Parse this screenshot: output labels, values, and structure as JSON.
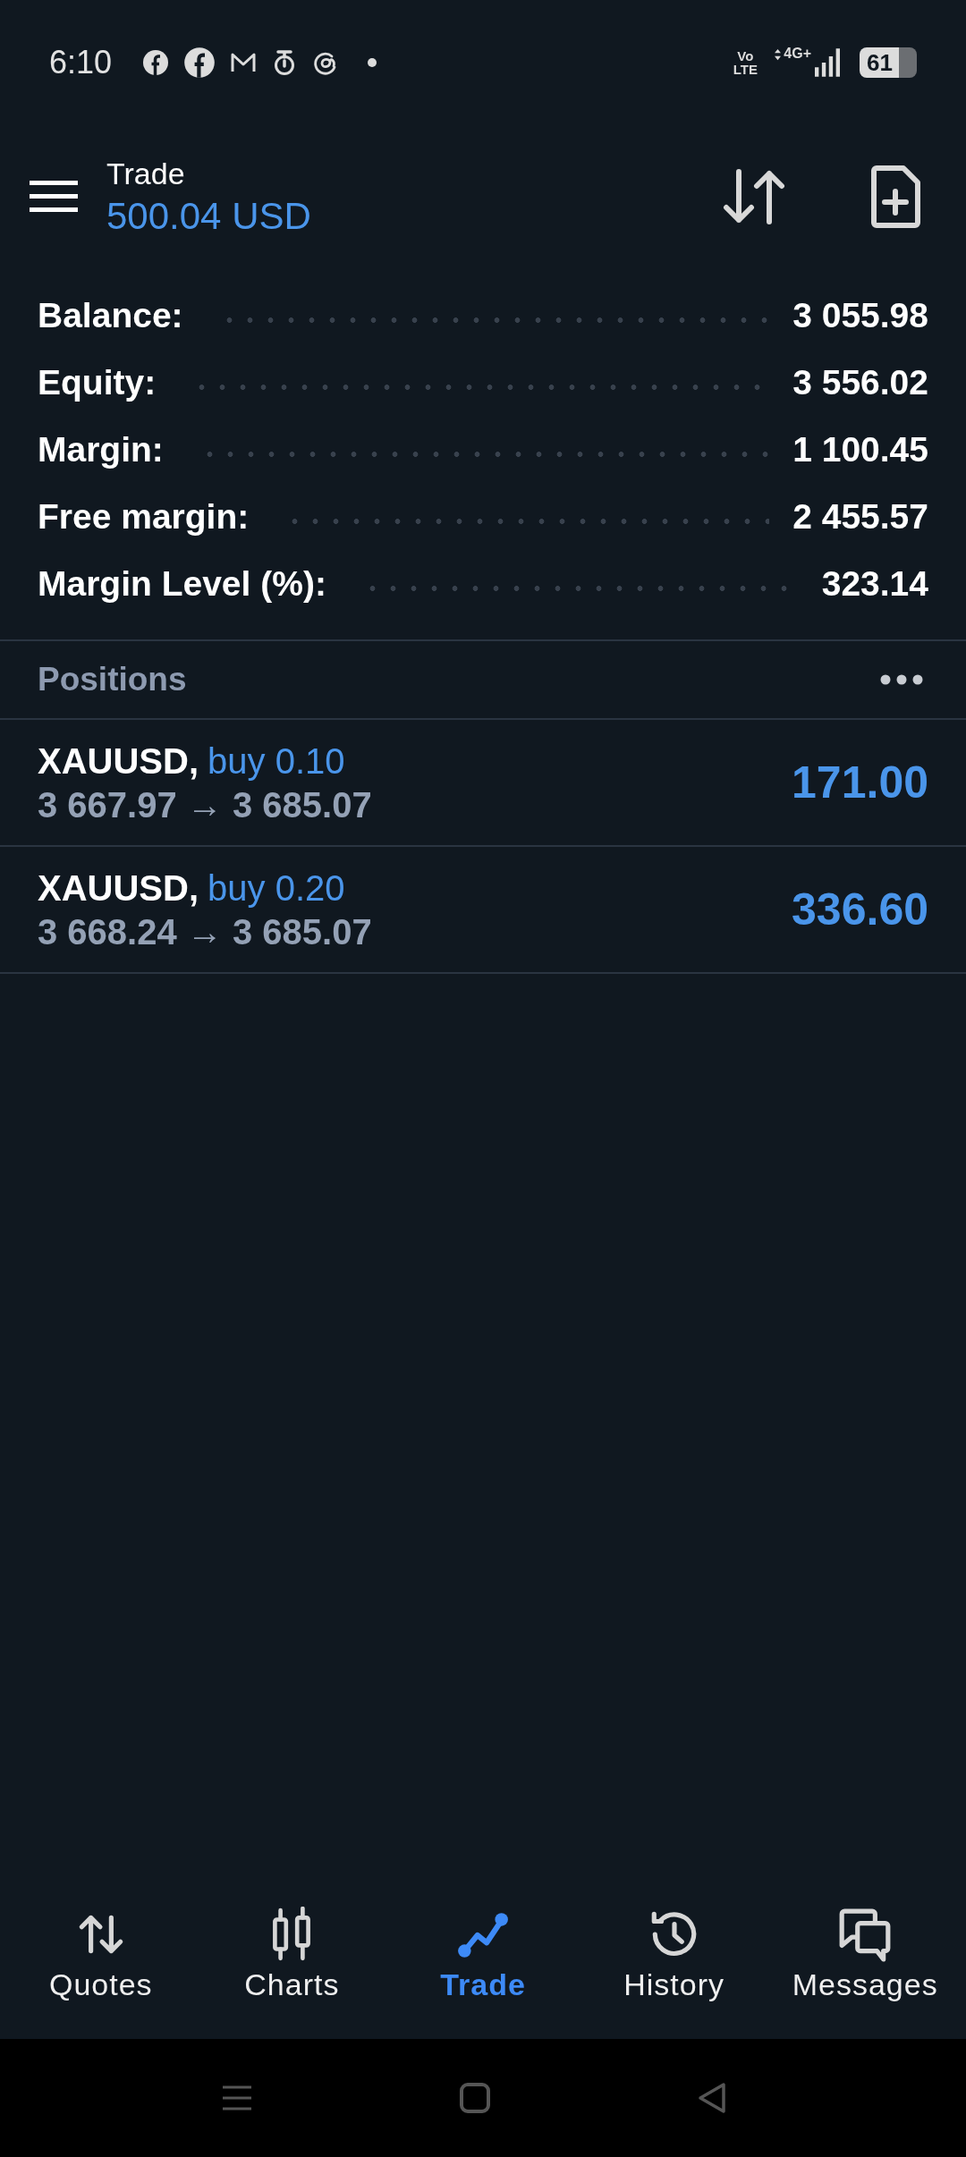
{
  "status_bar": {
    "time": "6:10",
    "volte": "Vo LTE",
    "network": "4G+",
    "battery": "61"
  },
  "header": {
    "title": "Trade",
    "balance": "500.04 USD"
  },
  "summary": [
    {
      "label": "Balance:",
      "value": "3 055.98"
    },
    {
      "label": "Equity:",
      "value": "3 556.02"
    },
    {
      "label": "Margin:",
      "value": "1 100.45"
    },
    {
      "label": "Free margin:",
      "value": "2 455.57"
    },
    {
      "label": "Margin Level (%):",
      "value": "323.14"
    }
  ],
  "positions": {
    "title": "Positions",
    "items": [
      {
        "symbol": "XAUUSD,",
        "side": "buy 0.10",
        "prices": "3 667.97 → 3 685.07",
        "profit": "171.00"
      },
      {
        "symbol": "XAUUSD,",
        "side": "buy 0.20",
        "prices": "3 668.24 → 3 685.07",
        "profit": "336.60"
      }
    ]
  },
  "bottom_nav": [
    {
      "label": "Quotes",
      "selected": false
    },
    {
      "label": "Charts",
      "selected": false
    },
    {
      "label": "Trade",
      "selected": true
    },
    {
      "label": "History",
      "selected": false
    },
    {
      "label": "Messages",
      "selected": false
    }
  ]
}
